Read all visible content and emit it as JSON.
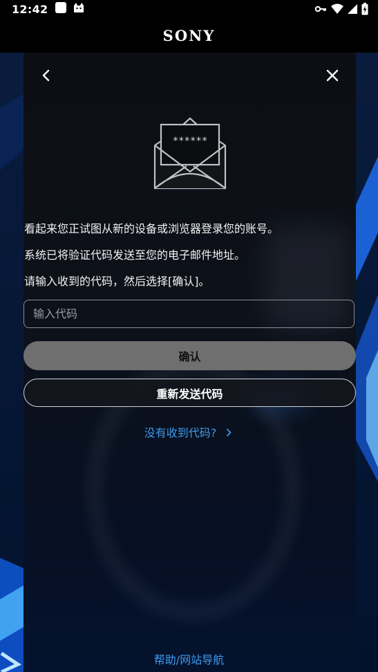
{
  "status_bar": {
    "time": "12:42",
    "icons": [
      "app-square-icon",
      "android-cat-icon",
      "vpn-key-icon",
      "wifi-icon",
      "signal-icon",
      "battery-charging-icon"
    ]
  },
  "header": {
    "brand": "SONY"
  },
  "nav": {
    "back_icon": "chevron-left-icon",
    "close_icon": "close-icon"
  },
  "envelope": {
    "masked_code": "******"
  },
  "messages": {
    "line1": "看起来您正试图从新的设备或浏览器登录您的账号。",
    "line2": "系统已将验证代码发送至您的电子邮件地址。",
    "line3": "请输入收到的代码，然后选择[确认]。"
  },
  "form": {
    "code_placeholder": "输入代码",
    "code_value": "",
    "confirm_label": "确认",
    "resend_label": "重新发送代码"
  },
  "links": {
    "no_code": "没有收到代码?",
    "help": "帮助/网站导航"
  },
  "colors": {
    "link": "#3d9bf0",
    "confirm_bg": "#6f6f6f",
    "accent_blue": "#1e90ff"
  }
}
